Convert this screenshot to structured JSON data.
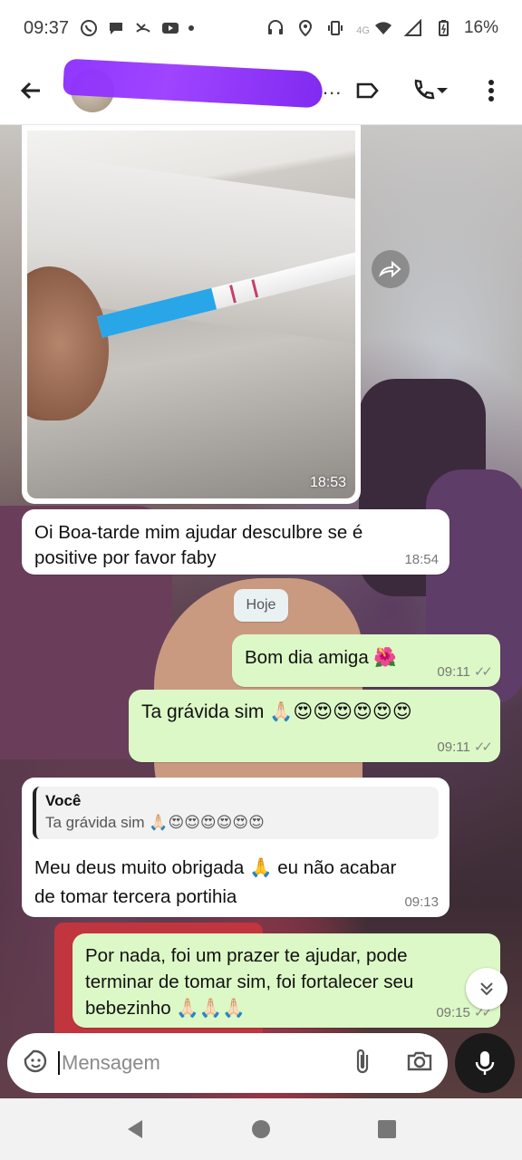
{
  "status_bar": {
    "time": "09:37",
    "network_label": "4G",
    "battery": "16%"
  },
  "header": {
    "contact_name_ellipsis": "..."
  },
  "messages": [
    {
      "id": "img",
      "type": "image",
      "time": "18:53"
    },
    {
      "id": "m1",
      "text": "Oi Boa-tarde mim ajudar desculbre se é positive por favor faby",
      "time": "18:54"
    },
    {
      "id": "m2",
      "text": "Bom dia amiga 🌺",
      "time": "09:11"
    },
    {
      "id": "m3",
      "text": "Ta grávida sim 🙏🏻😍😍😍😍😍😍",
      "time": "09:11"
    },
    {
      "id": "m4",
      "quote_author": "Você",
      "quote_text": "Ta grávida sim 🙏🏻😍😍😍😍😍😍",
      "text": "Meu deus muito obrigada 🙏 eu não acabar de tomar tercera portihia",
      "time": "09:13"
    },
    {
      "id": "m5",
      "text": "Por nada, foi um prazer te ajudar, pode terminar de tomar sim, foi fortalecer seu bebezinho 🙏🏻🙏🏻🙏🏻",
      "time": "09:15"
    }
  ],
  "date_chip": "Hoje",
  "input": {
    "placeholder": "Mensagem"
  },
  "colors": {
    "incoming_bubble": "#ffffff",
    "outgoing_bubble": "#dcf8c6",
    "mic_button": "#1a1a1a"
  },
  "icons": {
    "status": [
      "whatsapp-icon",
      "chat-icon",
      "missed-call-icon",
      "youtube-icon",
      "headset-icon",
      "location-icon",
      "vibrate-icon",
      "wifi-icon",
      "signal-icon",
      "battery-icon"
    ],
    "header": [
      "back-arrow-icon",
      "label-icon",
      "phone-icon",
      "dropdown-icon",
      "more-vert-icon"
    ],
    "input": [
      "sticker-icon",
      "attach-icon",
      "camera-icon",
      "mic-icon"
    ]
  }
}
